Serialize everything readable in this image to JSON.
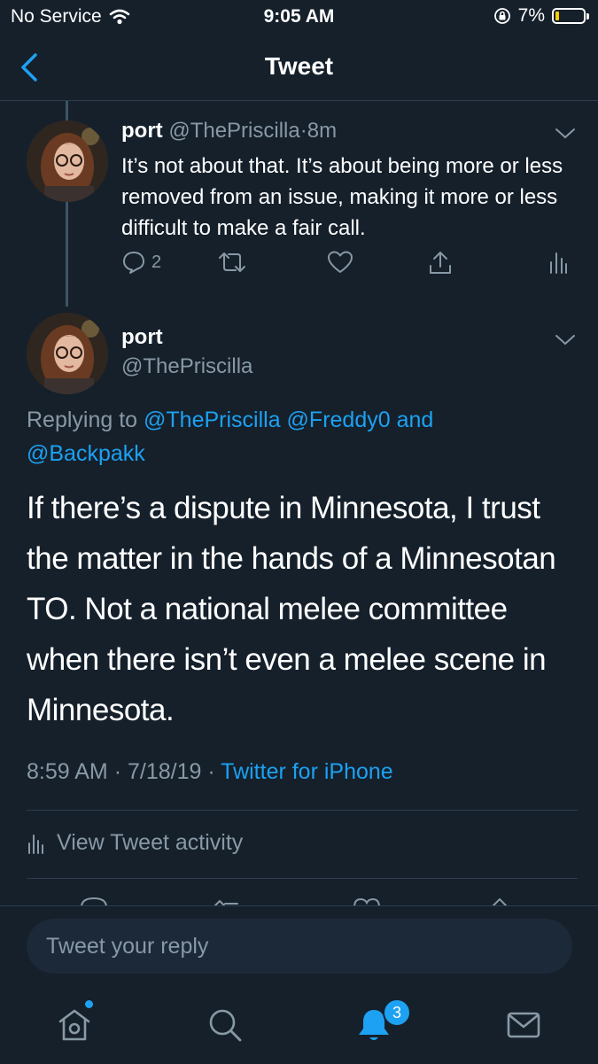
{
  "status_bar": {
    "carrier": "No Service",
    "time": "9:05 AM",
    "battery": "7%"
  },
  "nav": {
    "title": "Tweet"
  },
  "parent_tweet": {
    "display_name": "port",
    "handle": "@ThePriscilla",
    "separator": "·",
    "age": "8m",
    "text": "It’s not about that. It’s about being more or less removed from an issue, making it more or less difficult to make a fair call.",
    "reply_count": "2"
  },
  "main_tweet": {
    "display_name": "port",
    "handle": "@ThePriscilla",
    "replying_prefix": "Replying to",
    "mentions_line1": "@ThePriscilla @Freddy0 and",
    "mentions_line2": "@Backpakk",
    "text": "If there’s a dispute in Minnesota, I trust the matter in the hands of a Minnesotan TO. Not a national melee committee when there isn’t even a melee scene in Minnesota.",
    "time": "8:59 AM",
    "date": "7/18/19",
    "separator": "·",
    "source": "Twitter for iPhone",
    "activity_label": "View Tweet activity"
  },
  "composer": {
    "placeholder": "Tweet your reply"
  },
  "tab_bar": {
    "notifications_badge": "3"
  },
  "colors": {
    "background": "#15202b",
    "accent": "#1da1f2",
    "muted": "#8899a6",
    "divider": "#2d3d4d"
  }
}
